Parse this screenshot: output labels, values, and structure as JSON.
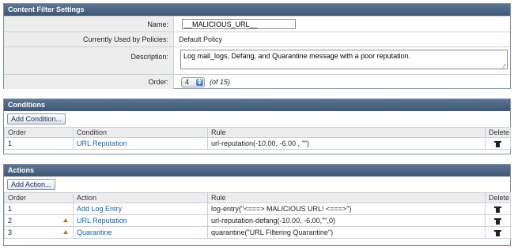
{
  "settings": {
    "title": "Content Filter Settings",
    "name_label": "Name:",
    "name_value": "__MALICIOUS_URL__",
    "policies_label": "Currently Used by Policies:",
    "policies_value": "Default Policy",
    "description_label": "Description:",
    "description_value": "Log mail_logs, Defang, and Quarantine message with a poor reputation.",
    "order_label": "Order:",
    "order_value": "4",
    "order_of": "(of 15)"
  },
  "conditions": {
    "title": "Conditions",
    "add_button": "Add Condition...",
    "columns": {
      "order": "Order",
      "condition": "Condition",
      "rule": "Rule",
      "delete": "Delete"
    },
    "rows": [
      {
        "order": "1",
        "condition": "URL Reputation",
        "rule": "url-reputation(-10.00, -6.00 , \"\")"
      }
    ]
  },
  "actions": {
    "title": "Actions",
    "add_button": "Add Action...",
    "columns": {
      "order": "Order",
      "action": "Action",
      "rule": "Rule",
      "delete": "Delete"
    },
    "rows": [
      {
        "order": "1",
        "action": "Add Log Entry",
        "rule": "log-entry(\"<===> MALICIOUS URL! <===>\")"
      },
      {
        "order": "2",
        "action": "URL Reputation",
        "rule": "url-reputation-defang(-10.00, -6.00,\"\",0)"
      },
      {
        "order": "3",
        "action": "Quarantine",
        "rule": "quarantine(\"URL Filtering Quarantine\")"
      }
    ]
  },
  "colors": {
    "header": "#4a627f",
    "link": "#1f5da8",
    "label_bg": "#ededed",
    "move_arrow": "#b8741c"
  },
  "icons": {
    "delete": "trash-icon",
    "move": "move-up-icon",
    "select": "select-arrows-icon"
  }
}
